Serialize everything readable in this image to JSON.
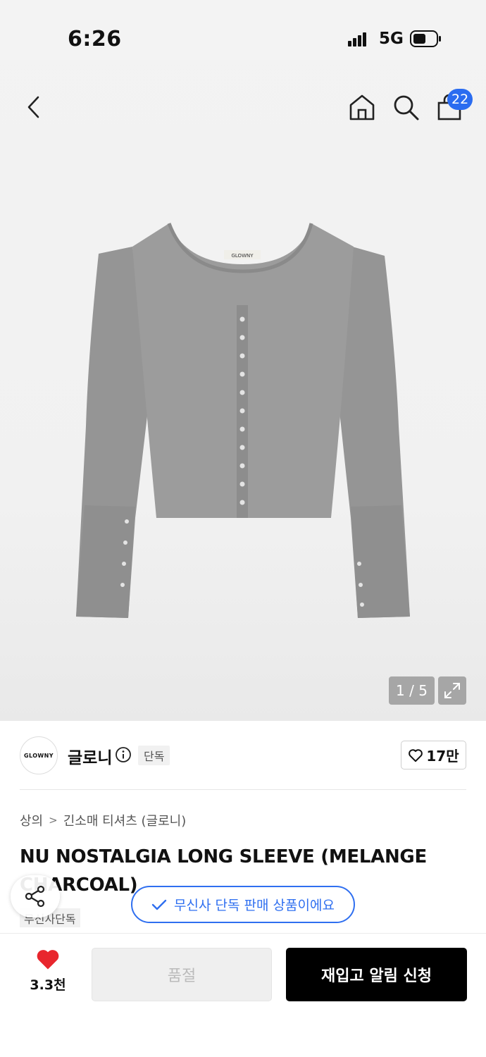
{
  "status_bar": {
    "time": "6:26",
    "network": "5G"
  },
  "nav": {
    "cart_count": "22"
  },
  "gallery": {
    "counter": "1 / 5",
    "garment_label": "GLOWNY"
  },
  "brand": {
    "logo_text": "GLOWNY",
    "name": "글로니",
    "exclusive_label": "단독",
    "likes": "17만"
  },
  "breadcrumb": {
    "category": "상의",
    "subcategory": "긴소매 티셔츠 (글로니)"
  },
  "product": {
    "title": "NU NOSTALGIA LONG SLEEVE (MELANGE CHARCOAL)",
    "tag": "무신사단독"
  },
  "toast": {
    "text": "무신사 단독 판매 상품이에요"
  },
  "bottom_bar": {
    "like_count": "3.3천",
    "soldout_label": "품절",
    "restock_label": "재입고 알림 신청"
  },
  "colors": {
    "accent_blue": "#2f6ff0",
    "heart_red": "#e8262d",
    "badge_blue": "#2a6cf0"
  }
}
